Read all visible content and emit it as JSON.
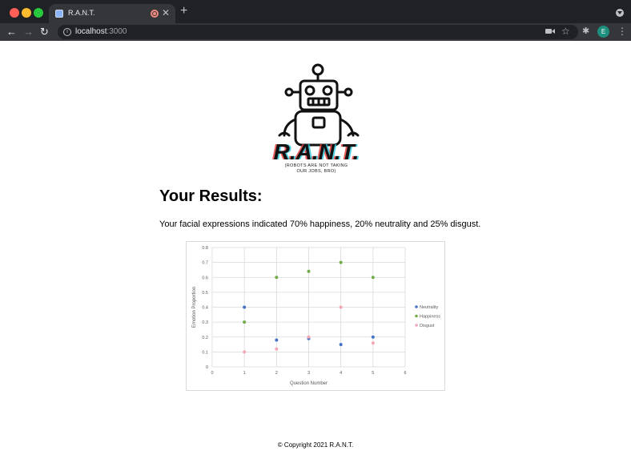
{
  "browser": {
    "tab_title": "R.A.N.T.",
    "tab_close": "✕",
    "new_tab": "+",
    "url_host": "localhost",
    "url_port": ":3000",
    "avatar_letter": "E"
  },
  "logo": {
    "wordmark": "R.A.N.T.",
    "tagline_line1": "(ROBOTS ARE NOT TAKING",
    "tagline_line2": "OUR JOBS, BRO)"
  },
  "results": {
    "title": "Your Results:",
    "summary": "Your facial expressions indicated 70% happiness, 20% neutrality and 25% disgust."
  },
  "footer": {
    "copyright": "© Copyright 2021 R.A.N.T."
  },
  "chart_data": {
    "type": "scatter",
    "xlabel": "Question Number",
    "ylabel": "Emotion Proportion",
    "xlim": [
      0,
      6
    ],
    "ylim": [
      0,
      0.8
    ],
    "xticks": [
      "0",
      "1",
      "2",
      "3",
      "4",
      "5",
      "6"
    ],
    "yticks": [
      "0",
      "0.1",
      "0.2",
      "0.3",
      "0.4",
      "0.5",
      "0.6",
      "0.7",
      "0.8"
    ],
    "grid": true,
    "legend_position": "right",
    "series": [
      {
        "name": "Neutrality",
        "color": "#4472c4",
        "x": [
          1,
          2,
          3,
          4,
          5
        ],
        "y": [
          0.4,
          0.18,
          0.19,
          0.15,
          0.2
        ]
      },
      {
        "name": "Happiness",
        "color": "#70ad47",
        "x": [
          1,
          2,
          3,
          4,
          5
        ],
        "y": [
          0.3,
          0.6,
          0.64,
          0.7,
          0.6
        ]
      },
      {
        "name": "Disgust",
        "color": "#f4a6b6",
        "x": [
          1,
          2,
          3,
          4,
          5
        ],
        "y": [
          0.1,
          0.12,
          0.2,
          0.4,
          0.16
        ]
      }
    ]
  }
}
